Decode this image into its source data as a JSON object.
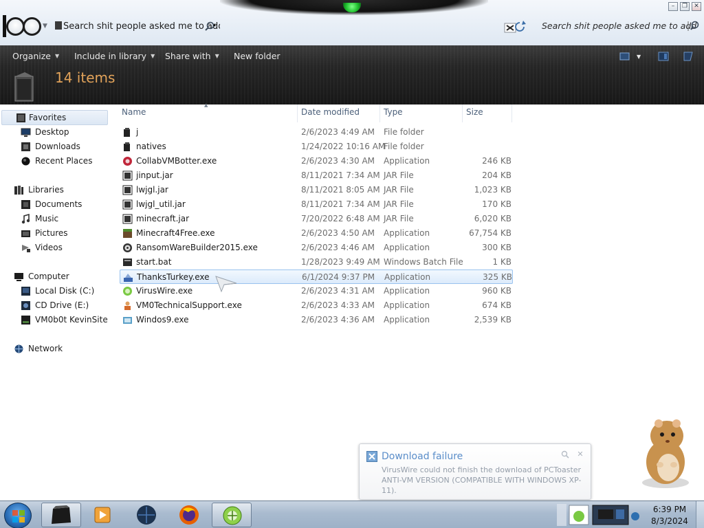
{
  "address_bar": {
    "path_text": "Search shit people asked me to add",
    "search_text": "Search shit people asked me to add"
  },
  "command_bar": {
    "organize": "Organize",
    "include_in_library": "Include in library",
    "share_with": "Share with",
    "new_folder": "New folder"
  },
  "header": {
    "item_count": "14 items"
  },
  "nav": {
    "favorites": "Favorites",
    "desktop": "Desktop",
    "downloads": "Downloads",
    "recent_places": "Recent Places",
    "libraries": "Libraries",
    "documents": "Documents",
    "music": "Music",
    "pictures": "Pictures",
    "videos": "Videos",
    "computer": "Computer",
    "local_disk": "Local Disk (C:)",
    "cd_drive": "CD Drive (E:)",
    "network_drive": "VM0b0t KevinSite",
    "network": "Network"
  },
  "columns": {
    "name": "Name",
    "date_modified": "Date modified",
    "type": "Type",
    "size": "Size"
  },
  "files": [
    {
      "name": "j",
      "date": "2/6/2023 4:49 AM",
      "type": "File folder",
      "size": ""
    },
    {
      "name": "natives",
      "date": "1/24/2022 10:16 AM",
      "type": "File folder",
      "size": ""
    },
    {
      "name": "CollabVMBotter.exe",
      "date": "2/6/2023 4:30 AM",
      "type": "Application",
      "size": "246 KB"
    },
    {
      "name": "jinput.jar",
      "date": "8/11/2021 7:34 AM",
      "type": "JAR File",
      "size": "204 KB"
    },
    {
      "name": "lwjgl.jar",
      "date": "8/11/2021 8:05 AM",
      "type": "JAR File",
      "size": "1,023 KB"
    },
    {
      "name": "lwjgl_util.jar",
      "date": "8/11/2021 7:34 AM",
      "type": "JAR File",
      "size": "170 KB"
    },
    {
      "name": "minecraft.jar",
      "date": "7/20/2022 6:48 AM",
      "type": "JAR File",
      "size": "6,020 KB"
    },
    {
      "name": "Minecraft4Free.exe",
      "date": "2/6/2023 4:50 AM",
      "type": "Application",
      "size": "67,754 KB"
    },
    {
      "name": "RansomWareBuilder2015.exe",
      "date": "2/6/2023 4:46 AM",
      "type": "Application",
      "size": "300 KB"
    },
    {
      "name": "start.bat",
      "date": "1/28/2023 9:49 AM",
      "type": "Windows Batch File",
      "size": "1 KB"
    },
    {
      "name": "ThanksTurkey.exe",
      "date": "6/1/2024 9:37 PM",
      "type": "Application",
      "size": "325 KB"
    },
    {
      "name": "VirusWire.exe",
      "date": "2/6/2023 4:31 AM",
      "type": "Application",
      "size": "960 KB"
    },
    {
      "name": "VM0TechnicalSupport.exe",
      "date": "2/6/2023 4:33 AM",
      "type": "Application",
      "size": "674 KB"
    },
    {
      "name": "Windos9.exe",
      "date": "2/6/2023 4:36 AM",
      "type": "Application",
      "size": "2,539 KB"
    }
  ],
  "notification": {
    "title": "Download failure",
    "body": "VirusWire could not finish the download of PCToaster ANTI-VM VERSION (COMPATIBLE WITH WINDOWS XP-11)."
  },
  "clock": {
    "time": "6:39 PM",
    "date": "8/3/2024"
  },
  "colors": {
    "header_count": "#e2a35a",
    "selection_border": "#99c2ee",
    "balloon_title": "#4f86c6"
  }
}
